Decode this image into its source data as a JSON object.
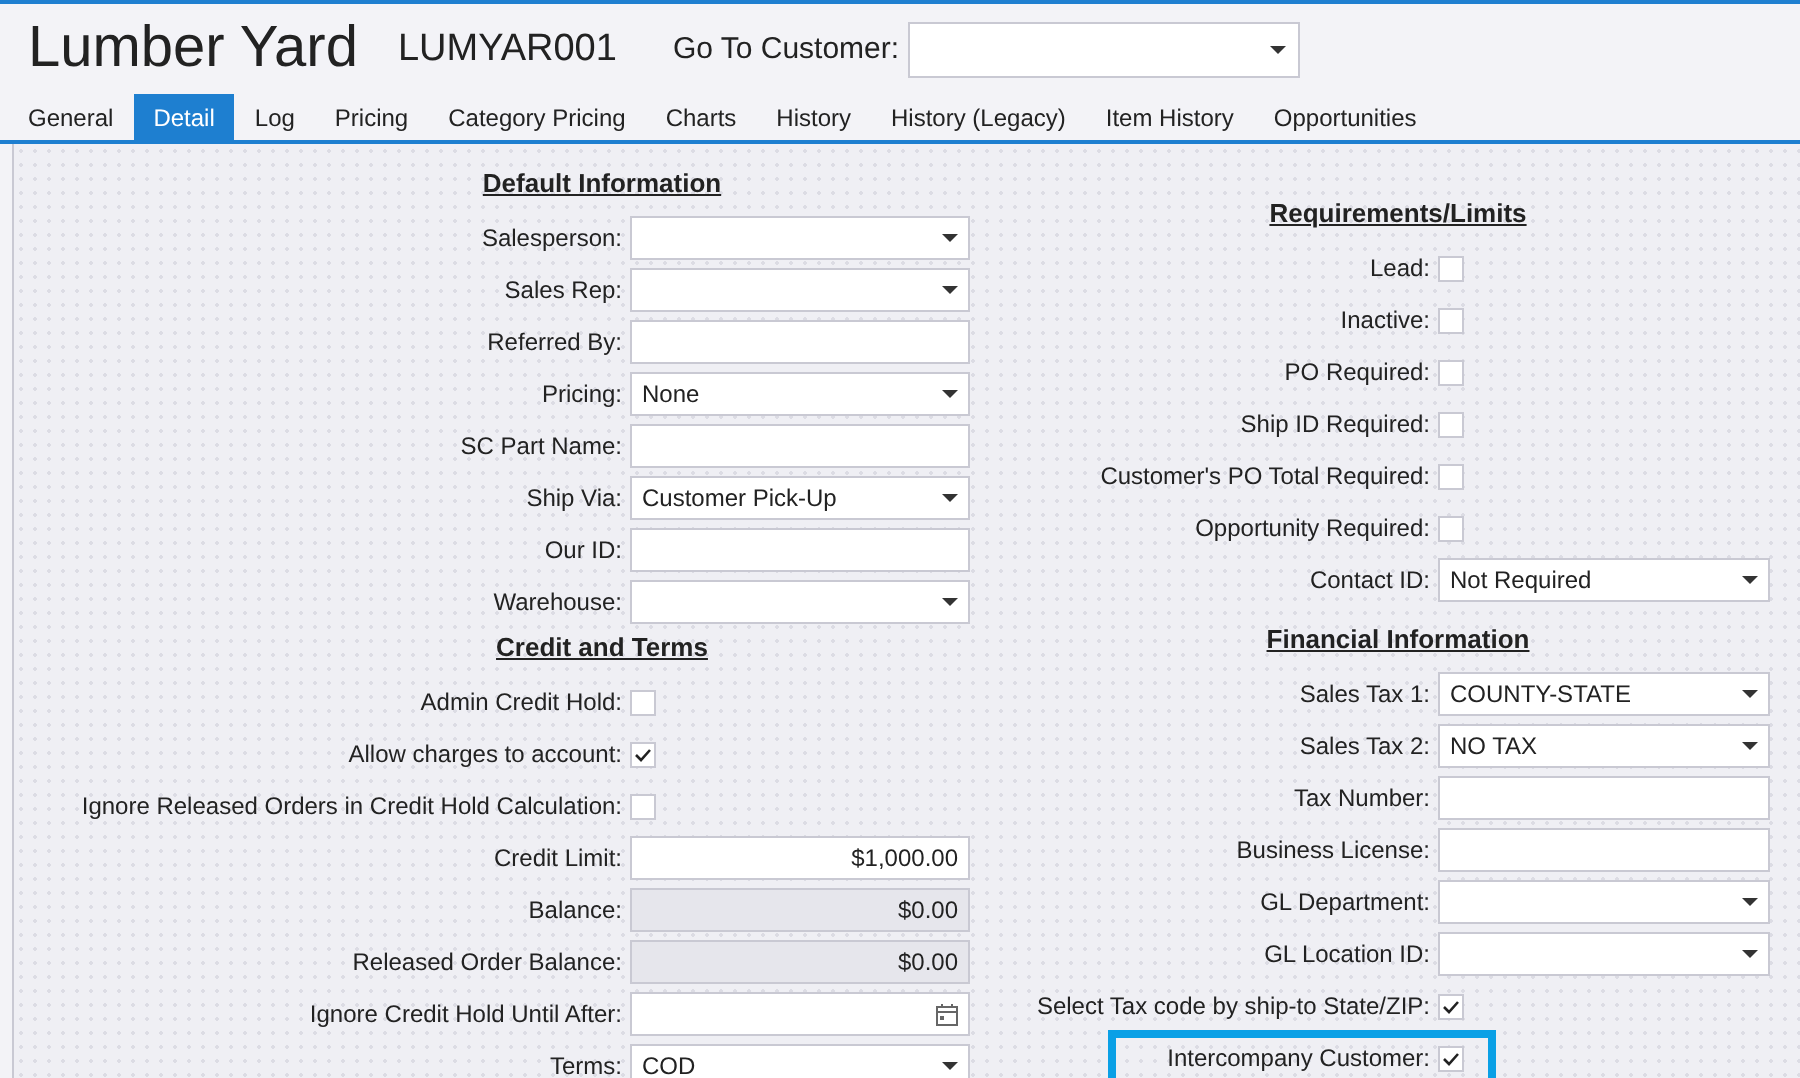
{
  "header": {
    "title": "Lumber Yard",
    "code": "LUMYAR001",
    "goto_label": "Go To Customer:"
  },
  "tabs": [
    {
      "label": "General",
      "selected": false
    },
    {
      "label": "Detail",
      "selected": true
    },
    {
      "label": "Log",
      "selected": false
    },
    {
      "label": "Pricing",
      "selected": false
    },
    {
      "label": "Category Pricing",
      "selected": false
    },
    {
      "label": "Charts",
      "selected": false
    },
    {
      "label": "History",
      "selected": false
    },
    {
      "label": "History (Legacy)",
      "selected": false
    },
    {
      "label": "Item History",
      "selected": false
    },
    {
      "label": "Opportunities",
      "selected": false
    }
  ],
  "columns": [
    {
      "sections": [
        {
          "title": "Default Information",
          "fields": [
            {
              "label": "Salesperson:",
              "kind": "select"
            },
            {
              "label": "Sales Rep:",
              "kind": "select"
            },
            {
              "label": "Referred By:",
              "kind": "text"
            },
            {
              "label": "Pricing:",
              "kind": "select",
              "value": "None"
            },
            {
              "label": "SC Part Name:",
              "kind": "text"
            },
            {
              "label": "Ship Via:",
              "kind": "select",
              "value": "Customer Pick-Up"
            },
            {
              "label": "Our ID:",
              "kind": "text"
            },
            {
              "label": "Warehouse:",
              "kind": "select"
            }
          ]
        },
        {
          "title": "Credit and Terms",
          "fields": [
            {
              "label": "Admin Credit Hold:",
              "kind": "checkbox",
              "checked": false
            },
            {
              "label": "Allow charges to account:",
              "kind": "checkbox",
              "checked": true
            },
            {
              "label": "Ignore Released Orders in Credit Hold Calculation:",
              "kind": "checkbox",
              "checked": false
            },
            {
              "label": "Credit Limit:",
              "kind": "amount",
              "value": "$1,000.00"
            },
            {
              "label": "Balance:",
              "kind": "readonly",
              "value": "$0.00"
            },
            {
              "label": "Released Order Balance:",
              "kind": "readonly",
              "value": "$0.00"
            },
            {
              "label": "Ignore Credit Hold Until After:",
              "kind": "date"
            },
            {
              "label": "Terms:",
              "kind": "select",
              "value": "COD"
            }
          ]
        }
      ]
    },
    {
      "sections": [
        {
          "title": "Requirements/Limits",
          "fields": [
            {
              "label": "Lead:",
              "kind": "checkbox",
              "checked": false
            },
            {
              "label": "Inactive:",
              "kind": "checkbox",
              "checked": false
            },
            {
              "label": "PO Required:",
              "kind": "checkbox",
              "checked": false
            },
            {
              "label": "Ship ID Required:",
              "kind": "checkbox",
              "checked": false
            },
            {
              "label": "Customer's PO Total Required:",
              "kind": "checkbox",
              "checked": false
            },
            {
              "label": "Opportunity Required:",
              "kind": "checkbox",
              "checked": false
            },
            {
              "label": "Contact ID:",
              "kind": "select",
              "value": "Not Required"
            }
          ]
        },
        {
          "title": "Financial Information",
          "fields": [
            {
              "label": "Sales Tax 1:",
              "kind": "select",
              "value": "COUNTY-STATE"
            },
            {
              "label": "Sales Tax 2:",
              "kind": "select",
              "value": "NO TAX"
            },
            {
              "label": "Tax Number:",
              "kind": "text"
            },
            {
              "label": "Business License:",
              "kind": "text"
            },
            {
              "label": "GL Department:",
              "kind": "select"
            },
            {
              "label": "GL Location ID:",
              "kind": "select"
            },
            {
              "label": "Select Tax code by ship-to State/ZIP:",
              "kind": "checkbox",
              "checked": true
            },
            {
              "label": "Intercompany Customer:",
              "kind": "checkbox",
              "checked": true,
              "highlighted": true
            }
          ]
        }
      ]
    }
  ]
}
